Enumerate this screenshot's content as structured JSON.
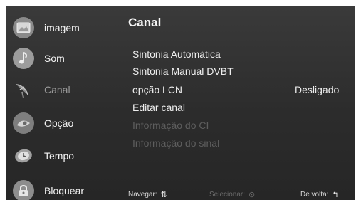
{
  "sidebar": {
    "items": [
      {
        "label": "imagem",
        "icon": "image-icon",
        "active": false
      },
      {
        "label": "Som",
        "icon": "music-note-icon",
        "active": false
      },
      {
        "label": "Canal",
        "icon": "satellite-dish-icon",
        "active": true
      },
      {
        "label": "Opção",
        "icon": "option-icon",
        "active": false
      },
      {
        "label": "Tempo",
        "icon": "clock-icon",
        "active": false
      },
      {
        "label": "Bloquear",
        "icon": "lock-icon",
        "active": false
      }
    ]
  },
  "main": {
    "title": "Canal",
    "rows": [
      {
        "label": "Sintonia Automática",
        "value": "",
        "disabled": false
      },
      {
        "label": "Sintonia Manual DVBT",
        "value": "",
        "disabled": false
      },
      {
        "label": "opção LCN",
        "value": "Desligado",
        "disabled": false
      },
      {
        "label": "Editar canal",
        "value": "",
        "disabled": false
      },
      {
        "label": "Informação do CI",
        "value": "",
        "disabled": true
      },
      {
        "label": "Informação do sinal",
        "value": "",
        "disabled": true
      }
    ]
  },
  "footer": {
    "navigate_label": "Navegar:",
    "select_label": "Selecionar:",
    "back_label": "De volta:"
  },
  "colors": {
    "background": "#2e2e2e",
    "text": "#ededed",
    "disabled_text": "#5e5e5e"
  }
}
